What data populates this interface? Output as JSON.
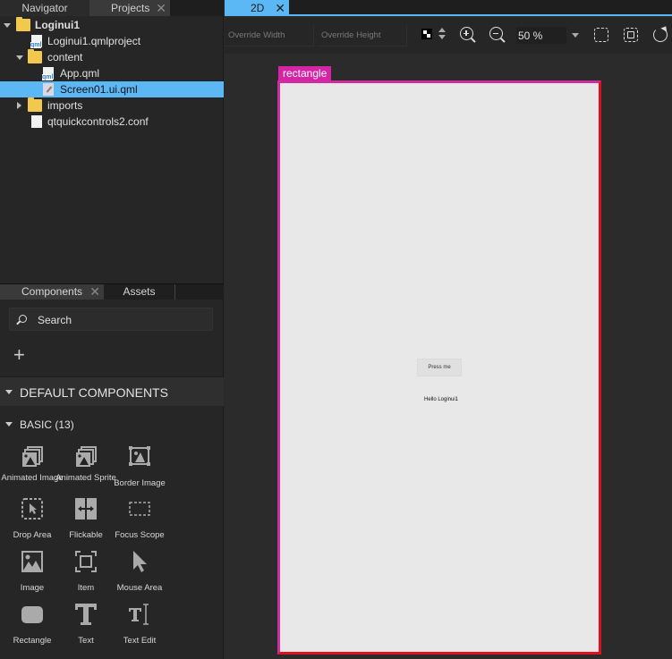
{
  "left_tabs": {
    "navigator": "Navigator",
    "projects": "Projects"
  },
  "tree": {
    "root": "Loginui1",
    "project_file": "Loginui1.qmlproject",
    "content_folder": "content",
    "app_file": "App.qml",
    "screen_file": "Screen01.ui.qml",
    "imports_folder": "imports",
    "conf_file": "qtquickcontrols2.conf"
  },
  "components": {
    "tab_components": "Components",
    "tab_assets": "Assets",
    "search_placeholder": "Search",
    "section": "DEFAULT COMPONENTS",
    "subsection": "BASIC (13)",
    "items": [
      {
        "label": "Animated Image",
        "icon": "animated-image-icon"
      },
      {
        "label": "Animated Sprite",
        "icon": "animated-sprite-icon"
      },
      {
        "label": "Border Image",
        "icon": "border-image-icon"
      },
      {
        "label": "Drop Area",
        "icon": "drop-area-icon"
      },
      {
        "label": "Flickable",
        "icon": "flickable-icon"
      },
      {
        "label": "Focus Scope",
        "icon": "focus-scope-icon"
      },
      {
        "label": "Image",
        "icon": "image-icon"
      },
      {
        "label": "Item",
        "icon": "item-icon"
      },
      {
        "label": "Mouse Area",
        "icon": "mouse-area-icon"
      },
      {
        "label": "Rectangle",
        "icon": "rectangle-icon"
      },
      {
        "label": "Text",
        "icon": "text-icon"
      },
      {
        "label": "Text Edit",
        "icon": "text-edit-icon"
      }
    ]
  },
  "editor": {
    "tab": "2D",
    "override_width_placeholder": "Override Width",
    "override_height_placeholder": "Override Height",
    "zoom_level": "50 %",
    "selection_label": "rectangle",
    "button_text": "Press me",
    "hello_text": "Hello Loginui1",
    "colors": {
      "accent": "#5cb8f5",
      "selection": "#d524a6",
      "bounds": "#e0111a"
    }
  }
}
